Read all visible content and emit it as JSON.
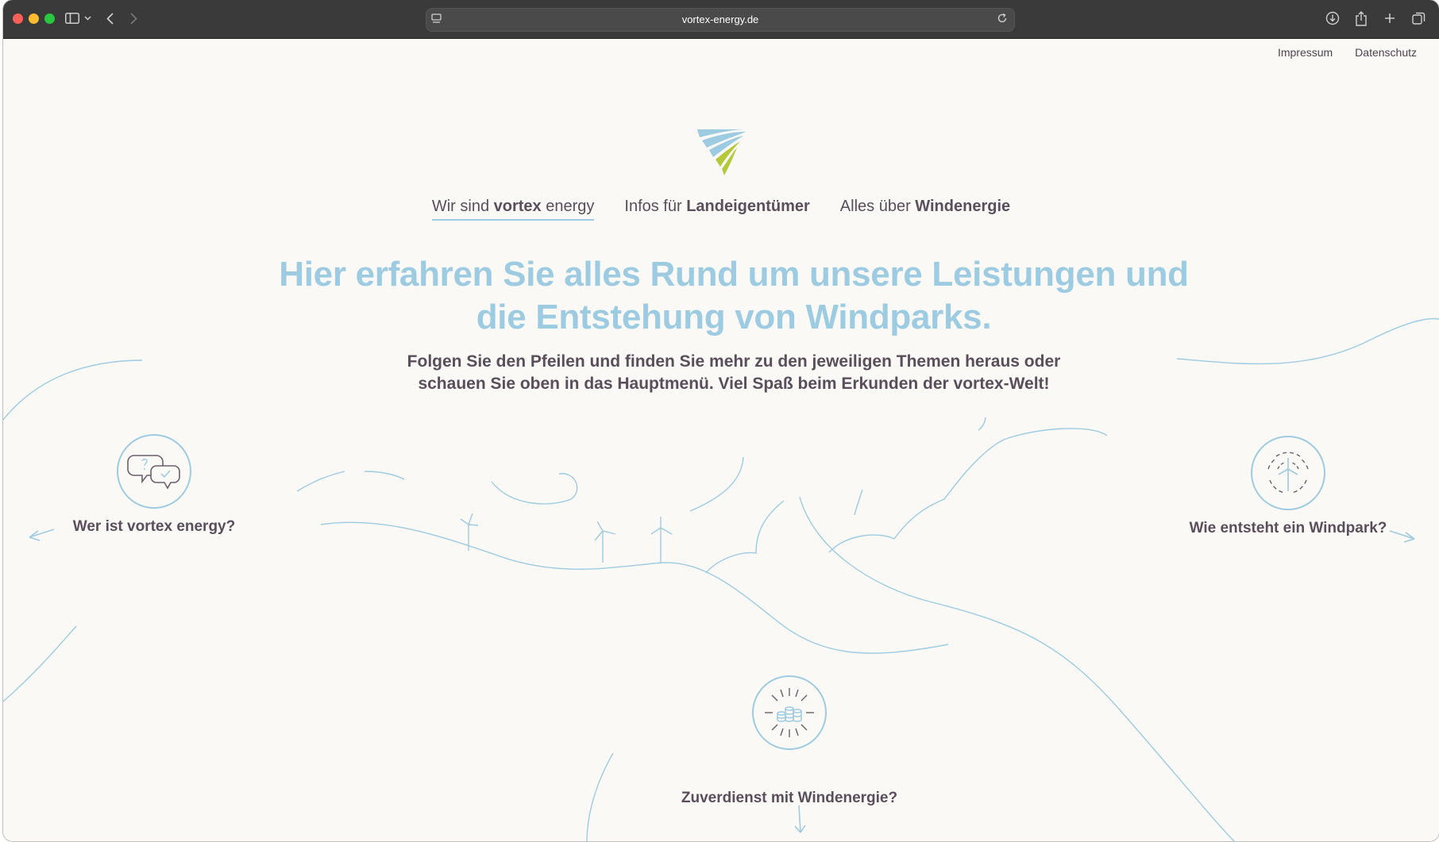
{
  "browser": {
    "url": "vortex-energy.de"
  },
  "toplinks": {
    "impressum": "Impressum",
    "datenschutz": "Datenschutz"
  },
  "nav": {
    "item1_prefix": "Wir sind",
    "item1_bold": "vortex",
    "item1_suffix": "energy",
    "item2_prefix": "Infos für",
    "item2_bold": "Landeigentümer",
    "item3_prefix": "Alles über",
    "item3_bold": "Windenergie"
  },
  "hero": {
    "headline_line1": "Hier erfahren Sie alles Rund um unsere Leistungen und",
    "headline_line2": "die Entstehung von Windparks.",
    "sub_line1": "Folgen Sie den Pfeilen und finden Sie mehr zu den jeweiligen Themen heraus oder",
    "sub_line2": "schauen Sie oben in das Hauptmenü. Viel Spaß beim Erkunden der vortex-Welt!"
  },
  "teasers": {
    "left": "Wer ist vortex energy?",
    "right": "Wie entsteht ein Windpark?",
    "bottom": "Zuverdienst mit Windenergie?"
  },
  "colors": {
    "accent_blue": "#9ccbe2",
    "text_purple": "#5a4e5c",
    "logo_green": "#b5c83a",
    "background": "#faf9f6"
  }
}
